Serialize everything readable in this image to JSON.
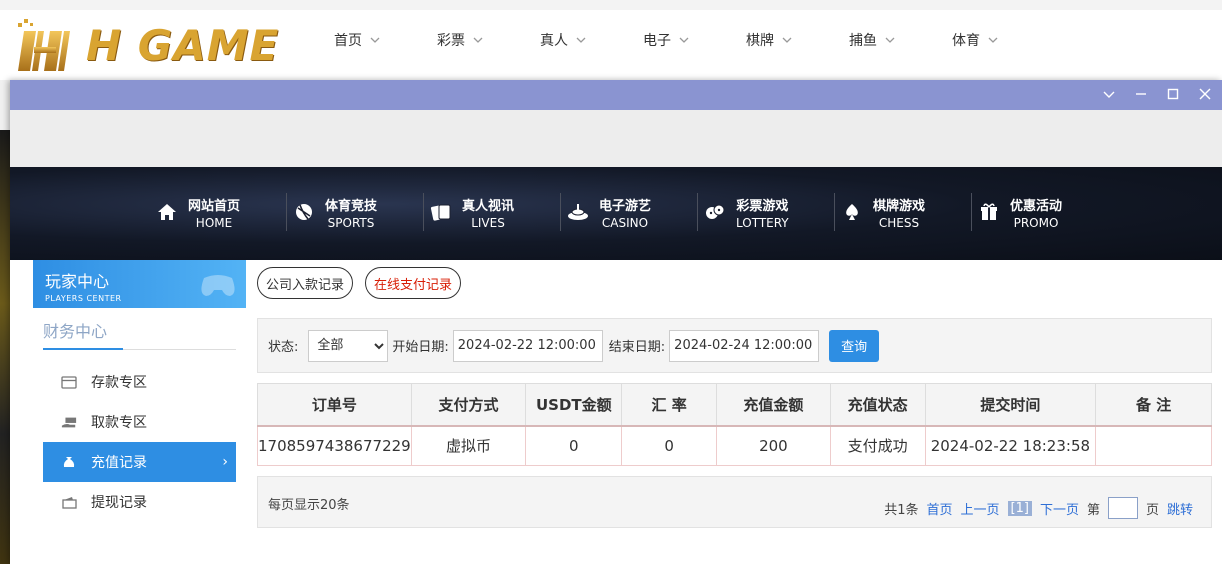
{
  "site": {
    "logo_text": "H GAME",
    "nav": [
      {
        "label": "首页"
      },
      {
        "label": "彩票"
      },
      {
        "label": "真人"
      },
      {
        "label": "电子"
      },
      {
        "label": "棋牌"
      },
      {
        "label": "捕鱼"
      },
      {
        "label": "体育"
      }
    ]
  },
  "banner_nav": [
    {
      "cn": "网站首页",
      "en": "HOME",
      "icon": "home-icon"
    },
    {
      "cn": "体育竞技",
      "en": "SPORTS",
      "icon": "ball-icon"
    },
    {
      "cn": "真人视讯",
      "en": "LIVES",
      "icon": "cards-icon"
    },
    {
      "cn": "电子游艺",
      "en": "CASINO",
      "icon": "slot-icon"
    },
    {
      "cn": "彩票游戏",
      "en": "LOTTERY",
      "icon": "dice-icon"
    },
    {
      "cn": "棋牌游戏",
      "en": "CHESS",
      "icon": "spade-icon"
    },
    {
      "cn": "优惠活动",
      "en": "PROMO",
      "icon": "gift-icon"
    }
  ],
  "sidebar": {
    "header_cn": "玩家中心",
    "header_en": "PLAYERS CENTER",
    "section": "财务中心",
    "items": [
      {
        "label": "存款专区",
        "icon": "card-icon"
      },
      {
        "label": "取款专区",
        "icon": "hand-money-icon"
      },
      {
        "label": "充值记录",
        "icon": "money-bag-icon"
      },
      {
        "label": "提现记录",
        "icon": "wallet-icon"
      }
    ]
  },
  "tabs": [
    {
      "label": "公司入款记录"
    },
    {
      "label": "在线支付记录"
    }
  ],
  "filter": {
    "status_label": "状态:",
    "status_value": "全部",
    "start_label": "开始日期:",
    "start_value": "2024-02-22 12:00:00",
    "end_label": "结束日期:",
    "end_value": "2024-02-24 12:00:00",
    "query_label": "查询"
  },
  "table": {
    "headers": [
      "订单号",
      "支付方式",
      "USDT金额",
      "汇 率",
      "充值金额",
      "充值状态",
      "提交时间",
      "备 注"
    ],
    "rows": [
      [
        "1708597438677229",
        "虚拟币",
        "0",
        "0",
        "200",
        "支付成功",
        "2024-02-22 18:23:58",
        ""
      ]
    ]
  },
  "pager": {
    "per_page": "每页显示20条",
    "total": "共1条",
    "first": "首页",
    "prev": "上一页",
    "current": "[1]",
    "next": "下一页",
    "goto_prefix": "第",
    "goto_suffix": "页",
    "jump": "跳转"
  },
  "colors": {
    "accent": "#2e8ee3",
    "title_bar": "#8a94d1",
    "logo_gold": "#d9a431",
    "red_tab": "#d81e06"
  }
}
